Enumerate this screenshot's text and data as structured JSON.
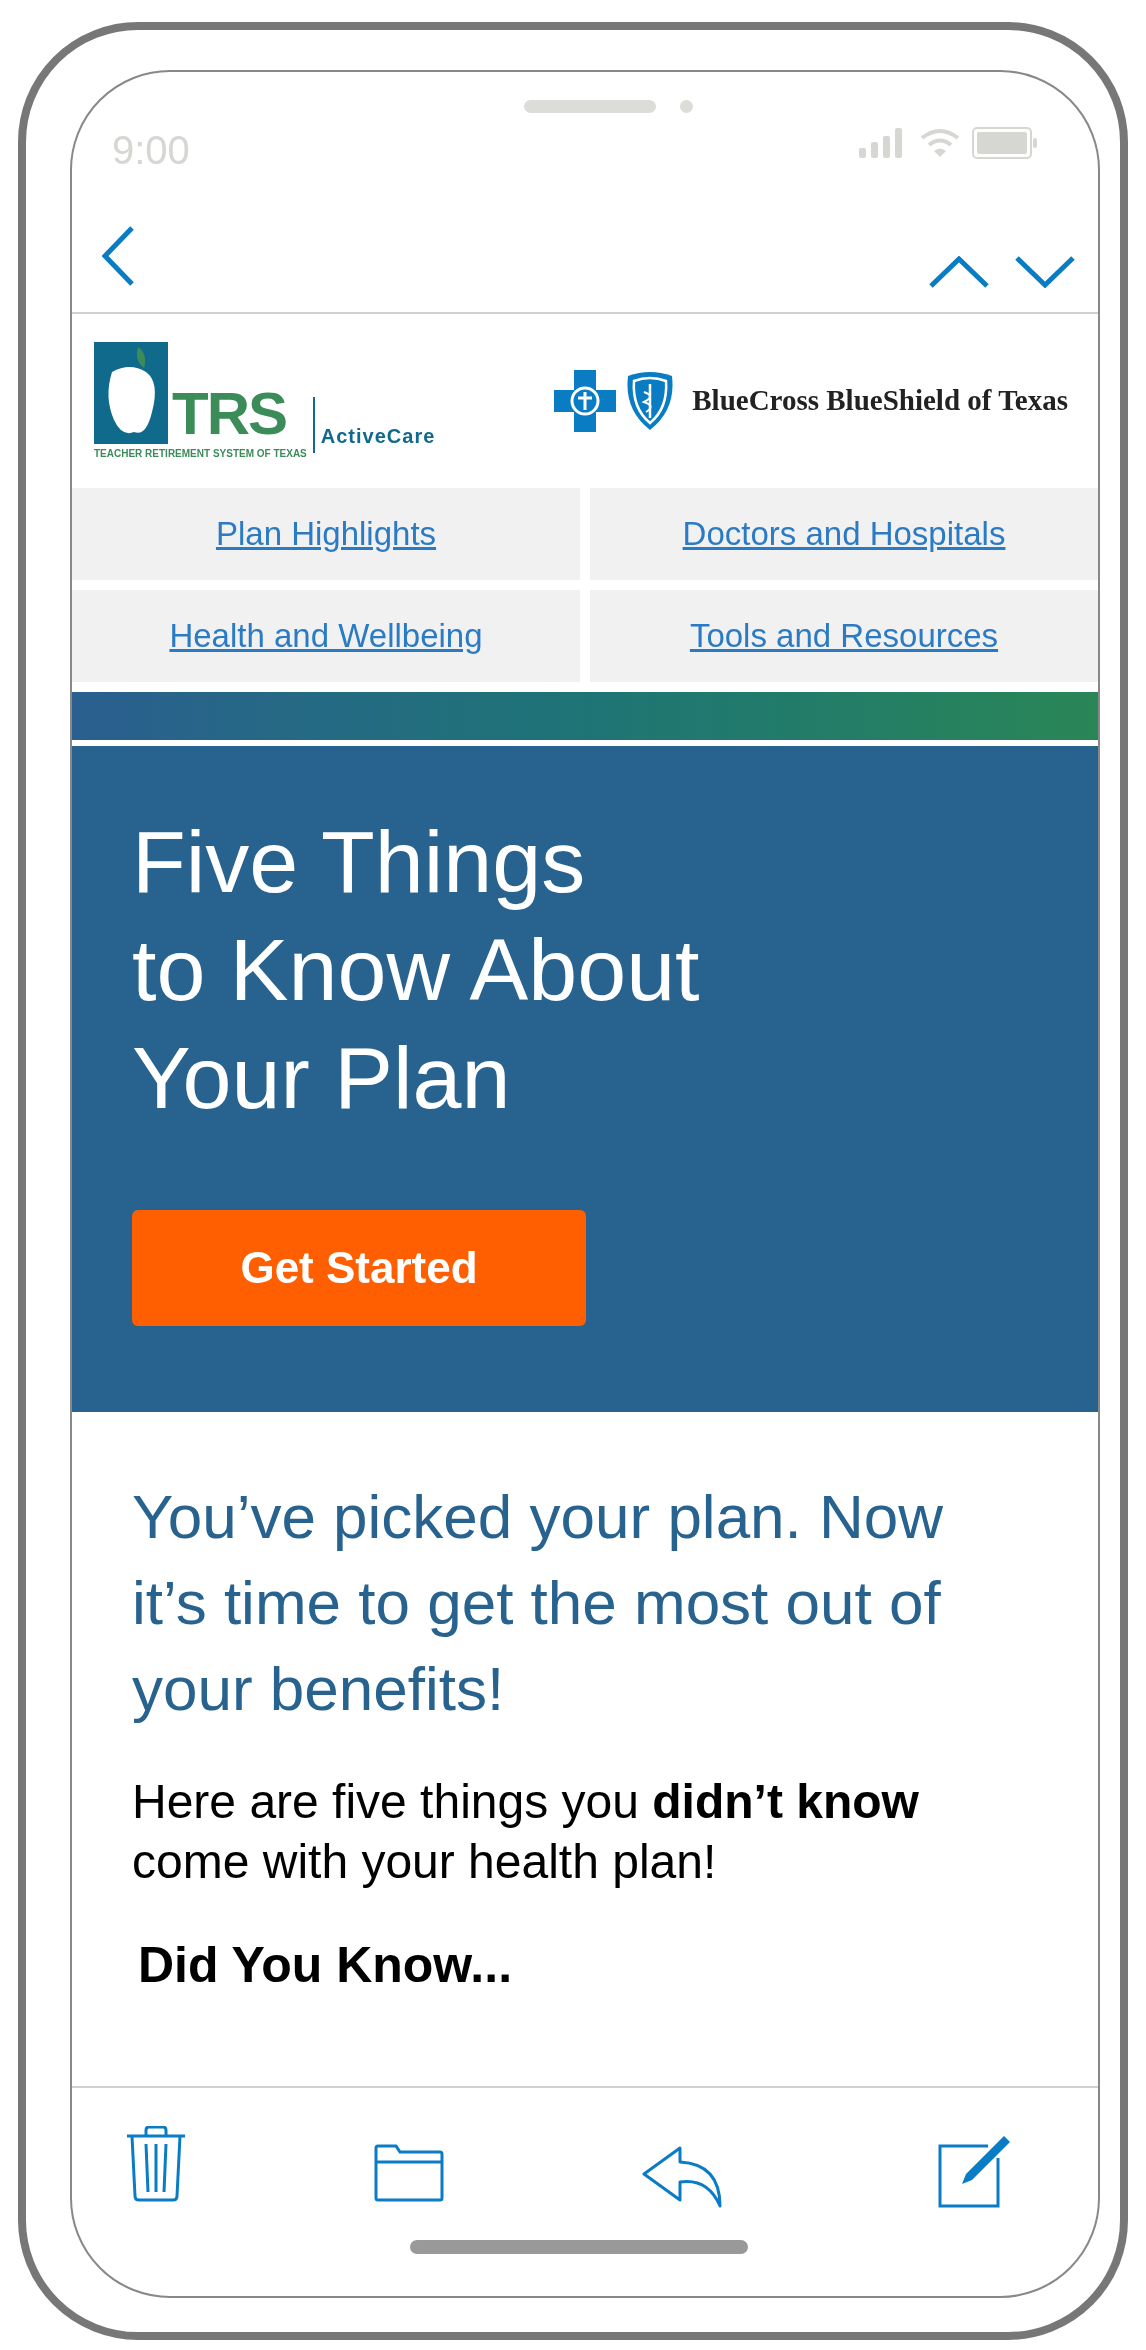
{
  "status_bar": {
    "time": "9:00"
  },
  "header": {
    "trs_logo": {
      "mark": "TRS",
      "product": "ActiveCare",
      "subtitle": "TEACHER RETIREMENT SYSTEM OF TEXAS"
    },
    "bcbs_logo": {
      "name": "BlueCross BlueShield of Texas"
    }
  },
  "nav_links": [
    "Plan Highlights",
    "Doctors and Hospitals",
    "Health and Wellbeing",
    "Tools and Resources"
  ],
  "hero": {
    "title_lines": [
      "Five Things",
      "to Know About",
      "Your Plan"
    ],
    "button": "Get Started"
  },
  "intro": "You’ve picked your plan. Now it’s time to get the most out of your benefits!",
  "body": "Here are five things you **didn’t know** come with your health plan!",
  "section_heading": "Did You Know..."
}
